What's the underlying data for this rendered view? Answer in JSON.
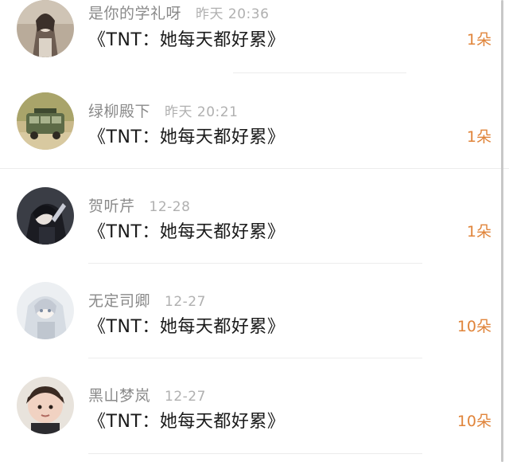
{
  "items": [
    {
      "name": "是你的学礼呀",
      "time": "昨天 20:36",
      "title": "《TNT：她每天都好累》",
      "count": "1朵",
      "avatar": "avatar-girl-sketch"
    },
    {
      "name": "绿柳殿下",
      "time": "昨天 20:21",
      "title": "《TNT：她每天都好累》",
      "count": "1朵",
      "avatar": "avatar-vintage-bus"
    },
    {
      "name": "贺听芹",
      "time": "12-28",
      "title": "《TNT：她每天都好累》",
      "count": "1朵",
      "avatar": "avatar-anime-dark"
    },
    {
      "name": "无定司卿",
      "time": "12-27",
      "title": "《TNT：她每天都好累》",
      "count": "10朵",
      "avatar": "avatar-anime-light"
    },
    {
      "name": "黑山梦岚",
      "time": "12-27",
      "title": "《TNT：她每天都好累》",
      "count": "10朵",
      "avatar": "avatar-child-photo"
    }
  ],
  "colors": {
    "accent": "#e0843a",
    "name": "#8a8a8a",
    "time": "#b0b0b0",
    "title": "#1a1a1a"
  }
}
